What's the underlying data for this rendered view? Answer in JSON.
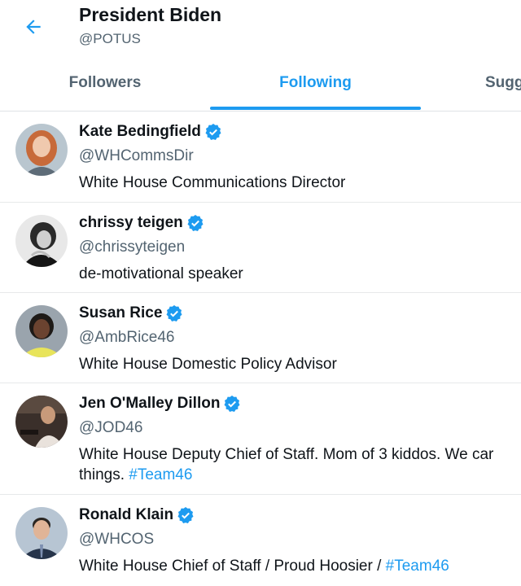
{
  "header": {
    "title": "President Biden",
    "handle": "@POTUS"
  },
  "tabs": [
    {
      "label": "Followers",
      "active": false
    },
    {
      "label": "Following",
      "active": true
    },
    {
      "label": "Sugg",
      "active": false
    }
  ],
  "colors": {
    "accent": "#1d9bf0",
    "text": "#0f1419",
    "secondary": "#536471",
    "divider": "#e7e9ea"
  },
  "users": [
    {
      "name": "Kate Bedingfield",
      "handle": "@WHCommsDir",
      "verified": true,
      "bio_line1": "White House Communications Director",
      "bio_line2_text": "",
      "hashtag": ""
    },
    {
      "name": "chrissy teigen",
      "handle": "@chrissyteigen",
      "verified": true,
      "bio_line1": "de-motivational speaker",
      "bio_line2_text": "",
      "hashtag": ""
    },
    {
      "name": "Susan Rice",
      "handle": "@AmbRice46",
      "verified": true,
      "bio_line1": "White House Domestic Policy Advisor",
      "bio_line2_text": "",
      "hashtag": ""
    },
    {
      "name": "Jen O'Malley Dillon",
      "handle": "@JOD46",
      "verified": true,
      "bio_line1": "White House Deputy Chief of Staff. Mom of 3 kiddos. We car",
      "bio_line2_text": "things. ",
      "hashtag": "#Team46"
    },
    {
      "name": "Ronald Klain",
      "handle": "@WHCOS",
      "verified": true,
      "bio_line1": "White House Chief of Staff / Proud Hoosier / ",
      "bio_line2_text": "",
      "hashtag": "#Team46"
    }
  ]
}
